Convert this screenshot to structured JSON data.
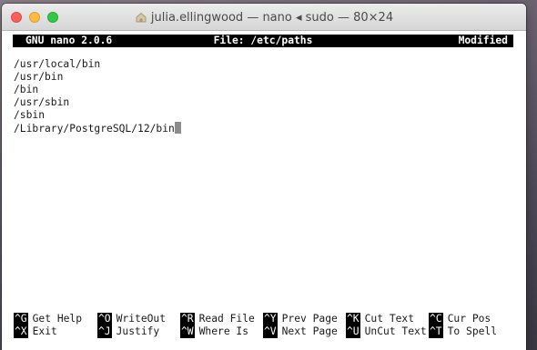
{
  "window": {
    "title": "julia.ellingwood — nano ◂ sudo — 80×24"
  },
  "nano": {
    "version": "GNU nano 2.0.6",
    "file": "File: /etc/paths",
    "status": "Modified",
    "lines": [
      "/usr/local/bin",
      "/usr/bin",
      "/bin",
      "/usr/sbin",
      "/sbin",
      "/Library/PostgreSQL/12/bin"
    ],
    "shortcuts_row1": [
      {
        "key": "^G",
        "label": "Get Help"
      },
      {
        "key": "^O",
        "label": "WriteOut"
      },
      {
        "key": "^R",
        "label": "Read File"
      },
      {
        "key": "^Y",
        "label": "Prev Page"
      },
      {
        "key": "^K",
        "label": "Cut Text"
      },
      {
        "key": "^C",
        "label": "Cur Pos"
      }
    ],
    "shortcuts_row2": [
      {
        "key": "^X",
        "label": "Exit"
      },
      {
        "key": "^J",
        "label": "Justify"
      },
      {
        "key": "^W",
        "label": "Where Is"
      },
      {
        "key": "^V",
        "label": "Next Page"
      },
      {
        "key": "^U",
        "label": "UnCut Text"
      },
      {
        "key": "^T",
        "label": "To Spell"
      }
    ]
  },
  "colors": {
    "close": "#fc605c",
    "minimize": "#fdbc40",
    "maximize": "#34c84a",
    "bar_bg": "#000000",
    "bar_fg": "#ffffff"
  }
}
